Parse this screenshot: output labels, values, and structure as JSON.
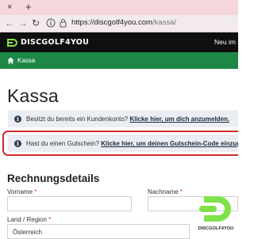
{
  "browser": {
    "tab_close": "×",
    "tab_new": "+",
    "url_host": "https://discgolf4you.com",
    "url_path": "/kassa/"
  },
  "header": {
    "logo_text": "DISCGOLF4YOU",
    "nav_right": "Neu im Sh",
    "brand_color": "#7fe24a"
  },
  "breadcrumb": {
    "label": "Kassa"
  },
  "page": {
    "title": "Kassa"
  },
  "notices": {
    "login_text": "Besitzt du bereits ein Kundenkonto? ",
    "login_link": "Klicke hier, um dich anzumelden.",
    "coupon_text": "Hast du einen Gutschein? ",
    "coupon_link": "Klicke hier, um deinen Gutschein-Code einzugeben."
  },
  "billing": {
    "section_title": "Rechnungsdetails",
    "first_name_label": "Vorname",
    "last_name_label": "Nachname",
    "country_label": "Land / Region",
    "required_marker": "*",
    "first_name_value": "",
    "last_name_value": "",
    "country_value": "Österreich"
  },
  "watermark": {
    "text": "DISCGOLF4YOU"
  }
}
